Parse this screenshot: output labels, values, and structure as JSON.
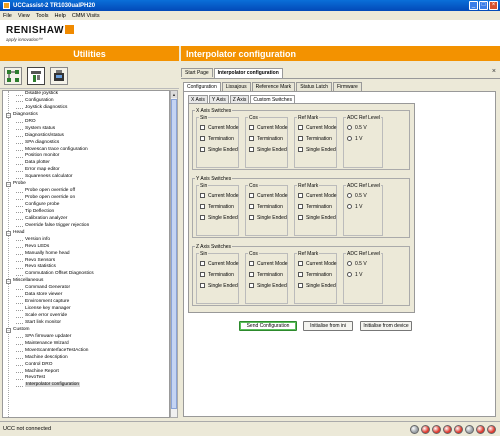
{
  "window": {
    "title": "UCCassist-2 TR1030ualPH20"
  },
  "menu": [
    "File",
    "View",
    "Tools",
    "Help",
    "CMM Visits"
  ],
  "logo": {
    "brand": "RENISHAW",
    "tagline": "apply innovation™"
  },
  "headers": {
    "left": "Utilities",
    "right": "Interpolator configuration"
  },
  "tree": [
    {
      "label": "Disable joystick",
      "level": 1
    },
    {
      "label": "Configuration",
      "level": 1
    },
    {
      "label": "Joystick diagnostics",
      "level": 1
    },
    {
      "label": "Diagnostics",
      "level": 0
    },
    {
      "label": "DRO",
      "level": 1
    },
    {
      "label": "System status",
      "level": 1
    },
    {
      "label": "Diagnostics/status",
      "level": 1
    },
    {
      "label": "SPA diagnostics",
      "level": 1
    },
    {
      "label": "Movescan trace configuration",
      "level": 1
    },
    {
      "label": "Position monitor",
      "level": 1
    },
    {
      "label": "Data plotter",
      "level": 1
    },
    {
      "label": "Error map editor",
      "level": 1
    },
    {
      "label": "Squareness calculator",
      "level": 1
    },
    {
      "label": "Probe",
      "level": 0
    },
    {
      "label": "Probe open override off",
      "level": 1
    },
    {
      "label": "Probe open override on",
      "level": 1
    },
    {
      "label": "Configure probe",
      "level": 1
    },
    {
      "label": "Tip Deflection",
      "level": 1
    },
    {
      "label": "Calibration analyzer",
      "level": 1
    },
    {
      "label": "Override false trigger rejection",
      "level": 1
    },
    {
      "label": "Head",
      "level": 0
    },
    {
      "label": "Version info",
      "level": 1
    },
    {
      "label": "Revo LEDs",
      "level": 1
    },
    {
      "label": "Manually home head",
      "level": 1
    },
    {
      "label": "Revo Sensors",
      "level": 1
    },
    {
      "label": "Revo statistics",
      "level": 1
    },
    {
      "label": "Commutation Offset Diagnostics",
      "level": 1
    },
    {
      "label": "Miscellaneous",
      "level": 0
    },
    {
      "label": "Command Generator",
      "level": 1
    },
    {
      "label": "Data store viewer",
      "level": 1
    },
    {
      "label": "Environment capture",
      "level": 1
    },
    {
      "label": "License key manager",
      "level": 1
    },
    {
      "label": "Scale error override",
      "level": 1
    },
    {
      "label": "Start link monitor",
      "level": 1
    },
    {
      "label": "Custom",
      "level": 0
    },
    {
      "label": "SPA firmware updater",
      "level": 1
    },
    {
      "label": "Maintenance Wizard",
      "level": 1
    },
    {
      "label": "MoveScanInterfaceTestAction",
      "level": 1
    },
    {
      "label": "Machine description",
      "level": 1
    },
    {
      "label": "Control DRO",
      "level": 1
    },
    {
      "label": "Machine Report",
      "level": 1
    },
    {
      "label": "RevoTest",
      "level": 1
    },
    {
      "label": "Interpolator configuration",
      "level": 1,
      "selected": true
    }
  ],
  "page_tabs": [
    "Start Page",
    "Interpolator configuration"
  ],
  "sub_tabs": [
    "Configuration",
    "Lissajous",
    "Reference Mark",
    "Status Latch",
    "Firmware"
  ],
  "axis_tabs": [
    "X Axis",
    "Y Axis",
    "Z Axis",
    "Custom Switches"
  ],
  "groups": [
    {
      "title": "X Axis Switches"
    },
    {
      "title": "Y Axis Switches"
    },
    {
      "title": "Z Axis Switches"
    }
  ],
  "sub_titles": {
    "sin": "Sin",
    "cos": "Cos",
    "refmark": "Ref Mark",
    "adc": "ADC Ref Level"
  },
  "checks": {
    "current": "Current Mode",
    "term": "Termination",
    "single": "Single Ended"
  },
  "radios": {
    "r05": "0.5 V",
    "r1": "1 V"
  },
  "buttons": {
    "send": "Send Configuration",
    "ini": "Initialise from ini",
    "device": "Initialise from device"
  },
  "status": {
    "text": "UCC not connected"
  },
  "led_colors": [
    "#9aa0a6",
    "#e03a2e",
    "#e03a2e",
    "#e03a2e",
    "#e03a2e",
    "#9aa0a6",
    "#e03a2e",
    "#e03a2e"
  ],
  "icons": [
    "tree-view-icon",
    "tools-icon",
    "machine-icon",
    "close-tab-icon"
  ]
}
